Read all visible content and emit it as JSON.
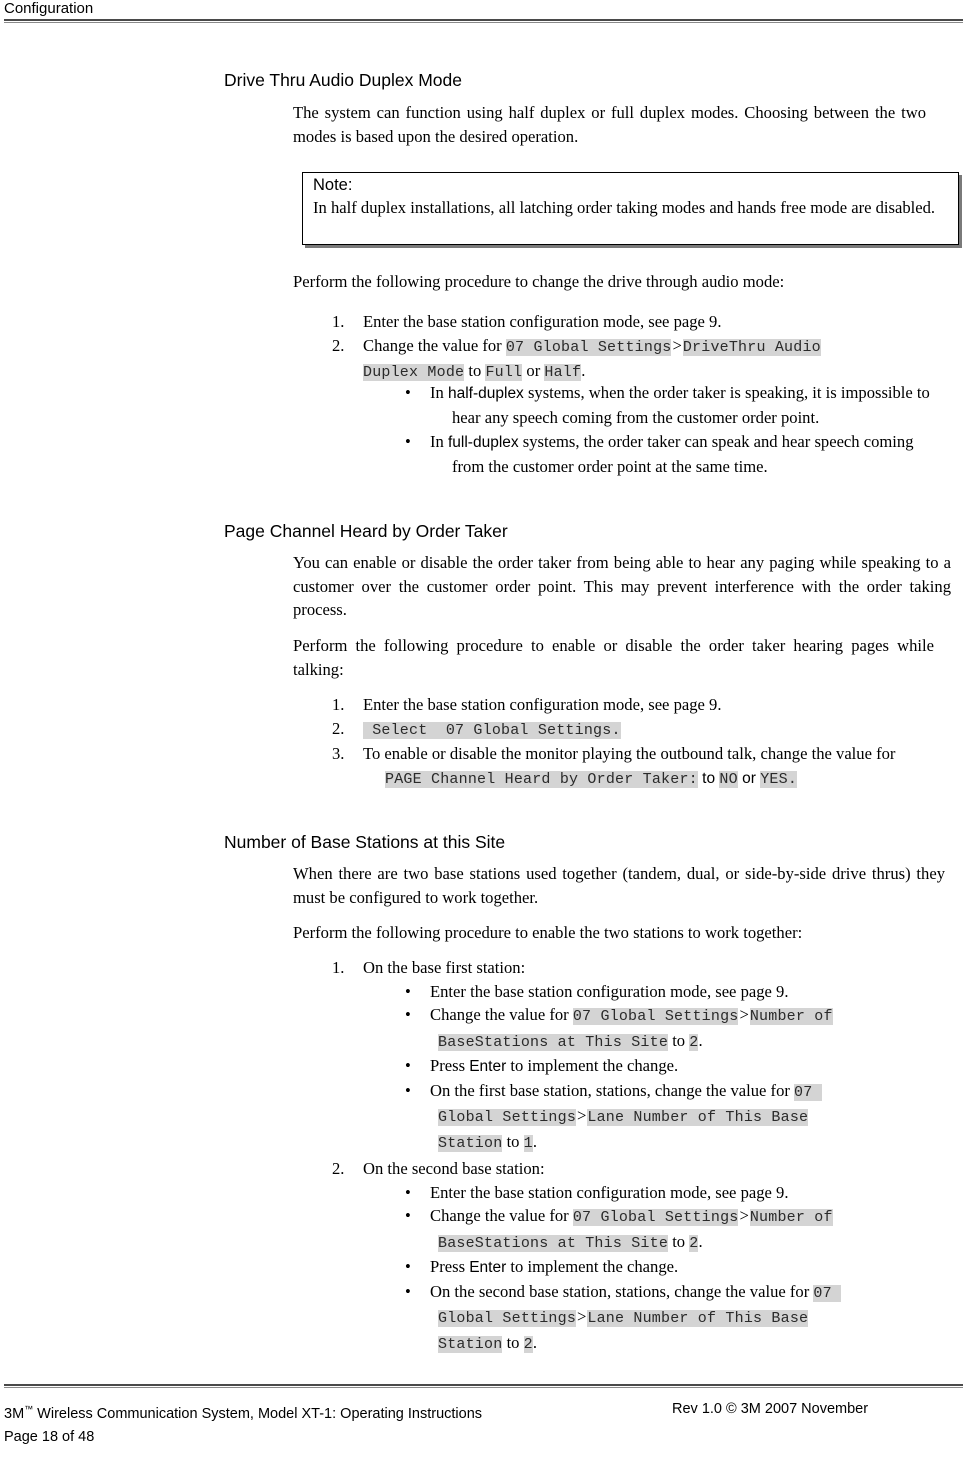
{
  "header": {
    "title": "Configuration"
  },
  "sections": [
    {
      "heading": "Drive Thru Audio Duplex Mode",
      "intro": "The system can function using half duplex or full duplex modes.  Choosing between the two modes is based upon the desired operation.",
      "note": {
        "label": "Note:",
        "body": "In half duplex installations, all latching order taking modes and hands free mode are disabled."
      },
      "lead": "Perform the following procedure to change the drive through audio mode:",
      "steps": [
        {
          "num": "1.",
          "text": "Enter the base station configuration mode, see page 9."
        },
        {
          "num": "2.",
          "prefix": "Change the value for ",
          "code1": "07 Global Settings",
          "sep": ">",
          "code2": "DriveThru Audio",
          "code3": "Duplex Mode",
          "mid": " to ",
          "code4": "Full",
          "conj": " or ",
          "code5": "Half",
          "suffix": "."
        }
      ],
      "bullets": [
        {
          "dot": "•",
          "pre": "In ",
          "term": "half-duplex",
          "post": " systems, when the order taker is speaking, it is impossible to hear any speech coming from the customer order point."
        },
        {
          "dot": "•",
          "pre": "In ",
          "term": "full-duplex",
          "post": " systems, the order taker can speak and hear speech coming from the customer order point at the same time."
        }
      ]
    },
    {
      "heading": "Page Channel Heard by Order Taker",
      "p1": "You can enable or disable the order taker from being able to hear any paging while speaking to a customer over the customer order point.  This may prevent interference with the order taking process.",
      "p2": "Perform the following procedure to enable or disable the order taker hearing pages while talking:",
      "steps": [
        {
          "num": "1.",
          "text": "Enter the base station configuration mode, see page 9."
        },
        {
          "num": "2.",
          "code1": " Select  07 Global Settings."
        },
        {
          "num": "3.",
          "prefix": "To enable or disable the monitor playing the outbound talk, change the value for ",
          "code1": "PAGE Channel Heard by Order Taker:",
          "mid": " to ",
          "code2": "NO",
          "conj": " or ",
          "code3": "YES.",
          "suffix": ""
        }
      ]
    },
    {
      "heading": "Number of Base Stations at this Site",
      "p1": "When there are two base stations used together (tandem, dual, or side-by-side drive thrus) they must be configured to work together.",
      "p2": "Perform the following procedure to enable the two stations to work together:",
      "steps": [
        {
          "num": "1.",
          "text": "On the base first station:",
          "bullets": [
            {
              "dot": "•",
              "text": "Enter the base station configuration mode, see page 9."
            },
            {
              "dot": "•",
              "prefix": "Change the value for ",
              "code1": "07 Global Settings",
              "sep": ">",
              "code2": "Number of",
              "code3": "BaseStations at This Site",
              "mid": " to ",
              "code4": "2",
              "suffix": "."
            },
            {
              "dot": "•",
              "pre": "Press ",
              "term": "Enter",
              "post": " to implement the change."
            },
            {
              "dot": "•",
              "prefix": "On the first base station, stations, change the value for ",
              "code1": "07 ",
              "code2": "Global Settings",
              "sep": ">",
              "code3": "Lane Number of This Base",
              "code4": "Station",
              "mid": " to ",
              "code5": "1",
              "suffix": "."
            }
          ]
        },
        {
          "num": "2.",
          "text": "On the second base station:",
          "bullets": [
            {
              "dot": "•",
              "text": "Enter the base station configuration mode, see page 9."
            },
            {
              "dot": "•",
              "prefix": "Change the value for ",
              "code1": "07 Global Settings",
              "sep": ">",
              "code2": "Number of",
              "code3": "BaseStations at This Site",
              "mid": " to ",
              "code4": "2",
              "suffix": "."
            },
            {
              "dot": "•",
              "pre": "Press ",
              "term": "Enter",
              "post": " to implement the change."
            },
            {
              "dot": "•",
              "prefix": "On the second base station, stations, change the value for ",
              "code1": "07 ",
              "code2": "Global Settings",
              "sep": ">",
              "code3": "Lane Number of This Base",
              "code4": "Station",
              "mid": " to ",
              "code5": "2",
              "suffix": "."
            }
          ]
        }
      ]
    }
  ],
  "footer": {
    "left_pre": "3M",
    "left_tm": "™",
    "left_post": " Wireless Communication System, Model XT-1: Operating Instructions",
    "right": "Rev 1.0 © 3M 2007 November",
    "page": "Page 18 of 48"
  }
}
